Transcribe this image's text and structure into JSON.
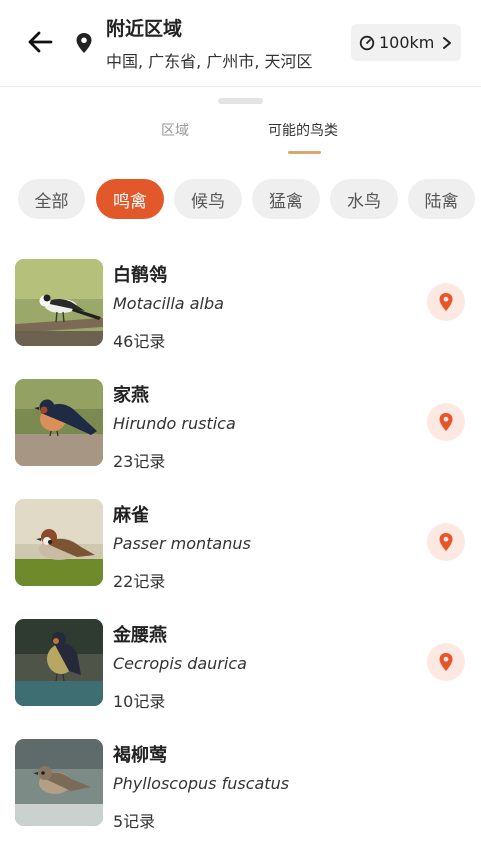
{
  "header": {
    "title": "附近区域",
    "location_path": "中国, 广东省, 广州市, 天河区",
    "range_label": "100km",
    "icons": {
      "back": "arrow-left-icon",
      "location": "map-pin-icon",
      "range": "clock-icon",
      "chevron": "chevron-right-icon"
    }
  },
  "tabs": [
    {
      "label": "区域",
      "active": false
    },
    {
      "label": "可能的鸟类",
      "active": true
    }
  ],
  "filters": [
    {
      "label": "全部",
      "active": false
    },
    {
      "label": "鸣禽",
      "active": true
    },
    {
      "label": "候鸟",
      "active": false
    },
    {
      "label": "猛禽",
      "active": false
    },
    {
      "label": "水鸟",
      "active": false
    },
    {
      "label": "陆禽",
      "active": false
    }
  ],
  "birds": [
    {
      "name": "白鹡鸰",
      "latin": "Motacilla alba",
      "count": "46记录",
      "has_location_button": true
    },
    {
      "name": "家燕",
      "latin": "Hirundo rustica",
      "count": "23记录",
      "has_location_button": true
    },
    {
      "name": "麻雀",
      "latin": "Passer montanus",
      "count": "22记录",
      "has_location_button": true
    },
    {
      "name": "金腰燕",
      "latin": "Cecropis daurica",
      "count": "10记录",
      "has_location_button": true
    },
    {
      "name": "褐柳莺",
      "latin": "Phylloscopus fuscatus",
      "count": "5记录",
      "has_location_button": false
    }
  ],
  "colors": {
    "accent": "#e2582b",
    "tab_underline": "#d9a66f",
    "chip_bg": "#efefef",
    "pin_bg": "#fde9e2"
  }
}
